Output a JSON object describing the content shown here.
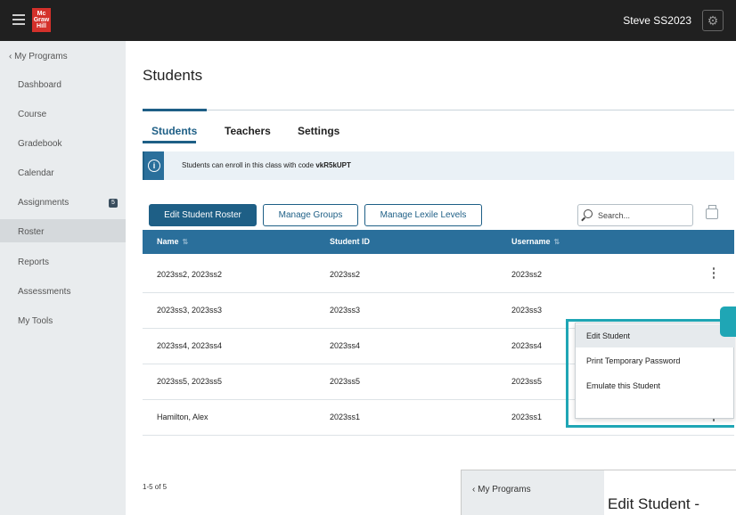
{
  "topbar": {
    "logo_lines": [
      "Mc",
      "Graw",
      "Hill"
    ],
    "user_name": "Steve SS2023"
  },
  "sidebar": {
    "back_label": "My Programs",
    "items": [
      {
        "label": "Dashboard"
      },
      {
        "label": "Course"
      },
      {
        "label": "Gradebook"
      },
      {
        "label": "Calendar"
      },
      {
        "label": "Assignments",
        "badge": "5"
      },
      {
        "label": "Roster",
        "active": true
      },
      {
        "label": "Reports"
      },
      {
        "label": "Assessments"
      },
      {
        "label": "My Tools"
      }
    ]
  },
  "main": {
    "title": "Students",
    "tabs": [
      {
        "label": "Students",
        "active": true
      },
      {
        "label": "Teachers"
      },
      {
        "label": "Settings"
      }
    ],
    "info": {
      "text": "Students can enroll in this class with code ",
      "code": "vkR5kUPT"
    },
    "toolbar": {
      "edit_roster": "Edit Student Roster",
      "manage_groups": "Manage Groups",
      "manage_lexile": "Manage Lexile Levels",
      "search_placeholder": "Search..."
    },
    "table": {
      "headers": [
        "Name",
        "Student ID",
        "Username"
      ],
      "rows": [
        [
          "2023ss2, 2023ss2",
          "2023ss2",
          "2023ss2"
        ],
        [
          "2023ss3, 2023ss3",
          "2023ss3",
          "2023ss3"
        ],
        [
          "2023ss4, 2023ss4",
          "2023ss4",
          "2023ss4"
        ],
        [
          "2023ss5, 2023ss5",
          "2023ss5",
          "2023ss5"
        ],
        [
          "Hamilton, Alex",
          "2023ss1",
          "2023ss1"
        ]
      ]
    },
    "pager": "1-5 of 5"
  },
  "context_menu": {
    "items": [
      "Edit Student",
      "Print Temporary Password",
      "Emulate this Student"
    ]
  },
  "inset": {
    "back_label": "My Programs",
    "title": "Edit Student -"
  },
  "colors": {
    "primary": "#1e5f86",
    "table_header": "#2a6f9b",
    "highlight": "#1fa6b5",
    "topbar": "#202020"
  }
}
